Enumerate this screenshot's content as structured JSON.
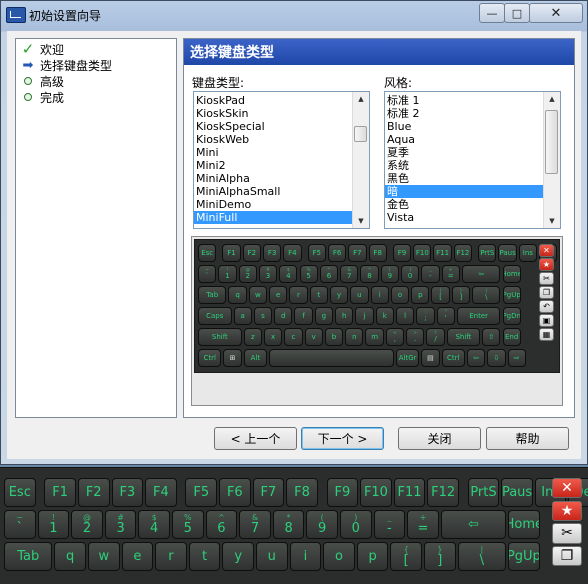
{
  "window": {
    "title": "初始设置向导",
    "min_glyph": "—",
    "max_glyph": "□",
    "close_glyph": "✕"
  },
  "nav": {
    "items": [
      {
        "label": "欢迎",
        "icon": "check-icon"
      },
      {
        "label": "选择键盘类型",
        "icon": "arrow-right-icon"
      },
      {
        "label": "高级",
        "icon": "step-dot-icon"
      },
      {
        "label": "完成",
        "icon": "step-dot-icon"
      }
    ]
  },
  "panel": {
    "title": "选择键盘类型",
    "keyboard_type_label": "键盘类型:",
    "style_label": "风格:",
    "keyboard_types": [
      "KioskPad",
      "KioskSkin",
      "KioskSpecial",
      "KioskWeb",
      "Mini",
      "Mini2",
      "MiniAlpha",
      "MiniAlphaSmall",
      "MiniDemo",
      "MiniFull"
    ],
    "keyboard_type_selected": "MiniFull",
    "styles": [
      "标准 1",
      "标准 2",
      "Blue",
      "Aqua",
      "夏季",
      "系统",
      "黑色",
      "暗",
      "金色",
      "Vista"
    ],
    "style_selected": "暗"
  },
  "buttons": {
    "back": "< 上一个",
    "next": "下一个 >",
    "close": "关闭",
    "help": "帮助"
  },
  "keyboard": {
    "rows": [
      [
        {
          "l": "Esc"
        },
        {
          "l": "F1"
        },
        {
          "l": "F2"
        },
        {
          "l": "F3"
        },
        {
          "l": "F4"
        },
        {
          "l": "F5"
        },
        {
          "l": "F6"
        },
        {
          "l": "F7"
        },
        {
          "l": "F8"
        },
        {
          "l": "F9"
        },
        {
          "l": "F10"
        },
        {
          "l": "F11"
        },
        {
          "l": "F12"
        },
        {
          "l": "PrtS"
        },
        {
          "l": "Paus"
        },
        {
          "l": "Ins"
        },
        {
          "l": "Del"
        }
      ],
      [
        {
          "l": "`",
          "s": "~"
        },
        {
          "l": "1",
          "s": "!"
        },
        {
          "l": "2",
          "s": "@"
        },
        {
          "l": "3",
          "s": "#"
        },
        {
          "l": "4",
          "s": "$"
        },
        {
          "l": "5",
          "s": "%"
        },
        {
          "l": "6",
          "s": "^"
        },
        {
          "l": "7",
          "s": "&"
        },
        {
          "l": "8",
          "s": "*"
        },
        {
          "l": "9",
          "s": "("
        },
        {
          "l": "0",
          "s": ")"
        },
        {
          "l": "-",
          "s": "_"
        },
        {
          "l": "=",
          "s": "+"
        },
        {
          "l": "⇦"
        },
        {
          "l": "Home"
        }
      ],
      [
        {
          "l": "Tab"
        },
        {
          "l": "q"
        },
        {
          "l": "w"
        },
        {
          "l": "e"
        },
        {
          "l": "r"
        },
        {
          "l": "t"
        },
        {
          "l": "y"
        },
        {
          "l": "u"
        },
        {
          "l": "i"
        },
        {
          "l": "o"
        },
        {
          "l": "p"
        },
        {
          "l": "[",
          "s": "{"
        },
        {
          "l": "]",
          "s": "}"
        },
        {
          "l": "\\",
          "s": "|"
        },
        {
          "l": "PgUp"
        }
      ],
      [
        {
          "l": "Caps"
        },
        {
          "l": "a"
        },
        {
          "l": "s"
        },
        {
          "l": "d"
        },
        {
          "l": "f"
        },
        {
          "l": "g"
        },
        {
          "l": "h"
        },
        {
          "l": "j"
        },
        {
          "l": "k"
        },
        {
          "l": "l"
        },
        {
          "l": ";",
          "s": ":"
        },
        {
          "l": "'",
          "s": "\""
        },
        {
          "l": "Enter"
        },
        {
          "l": "PgDn"
        }
      ],
      [
        {
          "l": "Shift"
        },
        {
          "l": "z"
        },
        {
          "l": "x"
        },
        {
          "l": "c"
        },
        {
          "l": "v"
        },
        {
          "l": "b"
        },
        {
          "l": "n"
        },
        {
          "l": "m"
        },
        {
          "l": ",",
          "s": "<"
        },
        {
          "l": ".",
          "s": ">"
        },
        {
          "l": "/",
          "s": "?"
        },
        {
          "l": "Shift"
        },
        {
          "l": "⇧"
        },
        {
          "l": "End"
        }
      ],
      [
        {
          "l": "Ctrl"
        },
        {
          "l": "⊞"
        },
        {
          "l": "Alt"
        },
        {
          "l": ""
        },
        {
          "l": "AltGr"
        },
        {
          "l": "▤"
        },
        {
          "l": "Ctrl"
        },
        {
          "l": "⇦"
        },
        {
          "l": "⇩"
        },
        {
          "l": "⇨"
        }
      ]
    ],
    "side_buttons": [
      {
        "name": "close-keyboard-icon",
        "glyph": "✕"
      },
      {
        "name": "language-flag-icon",
        "glyph": "★"
      },
      {
        "name": "settings-icon",
        "glyph": "✂"
      },
      {
        "name": "copy-icon",
        "glyph": "❐"
      },
      {
        "name": "undo-icon",
        "glyph": "↶"
      },
      {
        "name": "paste-icon",
        "glyph": "▣"
      },
      {
        "name": "keyboard-icon",
        "glyph": "▦"
      }
    ]
  },
  "colors": {
    "key_text": "#2cd07a",
    "selection": "#3399ff",
    "header_blue": "#2a52b8"
  }
}
